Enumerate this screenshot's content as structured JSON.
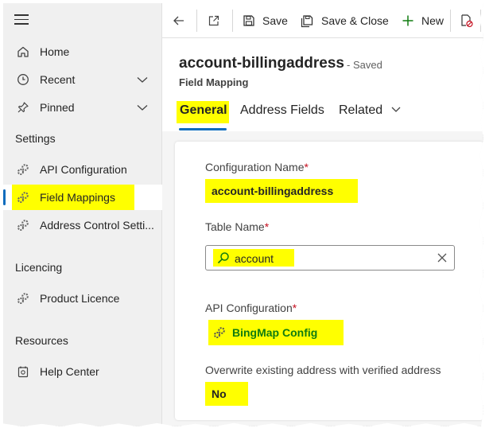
{
  "sidebar": {
    "items": [
      {
        "label": "Home",
        "icon": "home-icon"
      },
      {
        "label": "Recent",
        "icon": "clock-icon"
      },
      {
        "label": "Pinned",
        "icon": "pin-icon"
      }
    ],
    "settings_title": "Settings",
    "settings_items": [
      {
        "label": "API Configuration",
        "icon": "gears-icon"
      },
      {
        "label": "Field Mappings",
        "icon": "gears-icon"
      },
      {
        "label": "Address Control Setti...",
        "icon": "gears-icon"
      }
    ],
    "licencing_title": "Licencing",
    "licencing_items": [
      {
        "label": "Product Licence",
        "icon": "gears-icon"
      }
    ],
    "resources_title": "Resources",
    "resources_items": [
      {
        "label": "Help Center",
        "icon": "help-center-icon"
      }
    ]
  },
  "toolbar": {
    "save_label": "Save",
    "save_close_label": "Save & Close",
    "new_label": "New"
  },
  "record": {
    "title": "account-billingaddress",
    "status": "- Saved",
    "entity": "Field Mapping"
  },
  "tabs": [
    {
      "label": "General"
    },
    {
      "label": "Address Fields"
    },
    {
      "label": "Related"
    }
  ],
  "form": {
    "config_name_label": "Configuration Name",
    "config_name_value": "account-billingaddress",
    "table_name_label": "Table Name",
    "table_name_value": "account",
    "api_config_label": "API Configuration",
    "api_config_value": "BingMap Config",
    "overwrite_label": "Overwrite existing address with verified address",
    "overwrite_value": "No",
    "required_mark": "*"
  },
  "colors": {
    "highlight": "#ffff00",
    "accent": "#0f6cbd",
    "required": "#c50f1f",
    "new_icon": "#107c10"
  }
}
